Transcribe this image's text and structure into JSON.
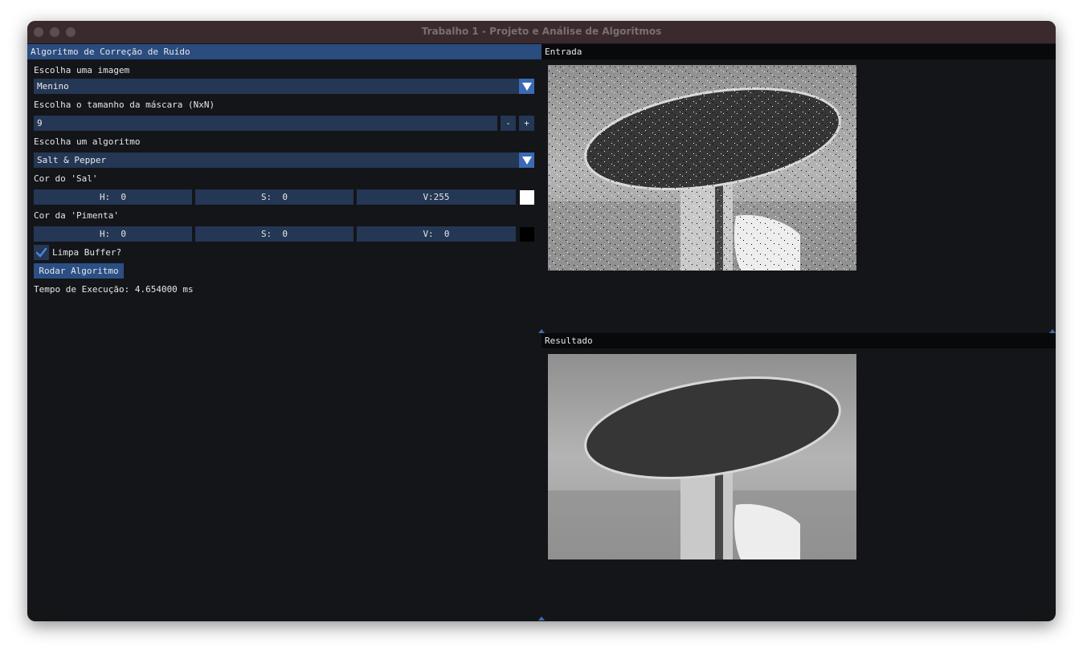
{
  "window": {
    "title": "Trabalho 1 - Projeto e Análise de Algoritmos"
  },
  "left_panel": {
    "title": "Algoritmo de Correção de Ruído",
    "image_label": "Escolha uma imagem",
    "image_selected": "Menino",
    "mask_label": "Escolha o tamanho da máscara (NxN)",
    "mask_value": "9",
    "minus_label": "-",
    "plus_label": "+",
    "algorithm_label": "Escolha um algoritmo",
    "algorithm_selected": "Salt & Pepper",
    "salt_label": "Cor do 'Sal'",
    "salt": {
      "h": "H:  0",
      "s": "S:  0",
      "v": "V:255",
      "color": "#ffffff"
    },
    "pepper_label": "Cor da 'Pimenta'",
    "pepper": {
      "h": "H:  0",
      "s": "S:  0",
      "v": "V:  0",
      "color": "#000000"
    },
    "clear_buffer_label": "Limpa Buffer?",
    "clear_buffer_checked": true,
    "run_button": "Rodar Algoritmo",
    "exec_time": "Tempo de Execução: 4.654000 ms"
  },
  "input_panel": {
    "title": "Entrada",
    "image_icon": "photo-boy-umbrella-noisy-icon"
  },
  "result_panel": {
    "title": "Resultado",
    "image_icon": "photo-boy-umbrella-clean-icon"
  },
  "colors": {
    "accent": "#3b69b5",
    "header_active": "#2a4c7f",
    "field": "#243754",
    "background": "#141519"
  }
}
